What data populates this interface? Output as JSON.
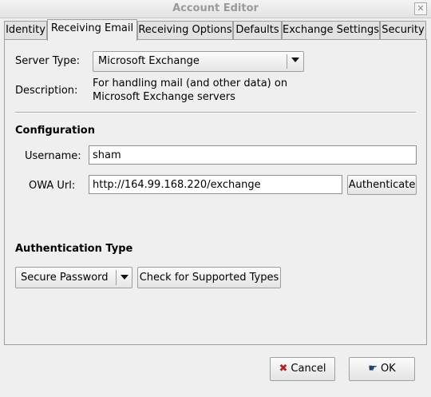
{
  "window": {
    "title": "Account Editor"
  },
  "tabs": [
    {
      "label": "Identity"
    },
    {
      "label": "Receiving Email"
    },
    {
      "label": "Receiving Options"
    },
    {
      "label": "Defaults"
    },
    {
      "label": "Exchange Settings"
    },
    {
      "label": "Security"
    }
  ],
  "server": {
    "type_label": "Server Type:",
    "type_value": "Microsoft Exchange",
    "description_label": "Description:",
    "description_line1": "For handling mail (and other data) on",
    "description_line2": "Microsoft Exchange servers"
  },
  "configuration": {
    "heading": "Configuration",
    "username_label": "Username:",
    "username_value": "sham",
    "owa_label": "OWA Url:",
    "owa_value": "http://164.99.168.220/exchange",
    "authenticate_label": "Authenticate"
  },
  "authentication": {
    "heading": "Authentication Type",
    "type_value": "Secure Password",
    "check_label": "Check for Supported Types"
  },
  "footer": {
    "cancel_label": "Cancel",
    "ok_label": "OK"
  },
  "icons": {
    "cancel": "x-icon",
    "ok": "ok-hand-icon",
    "close": "close-icon"
  }
}
